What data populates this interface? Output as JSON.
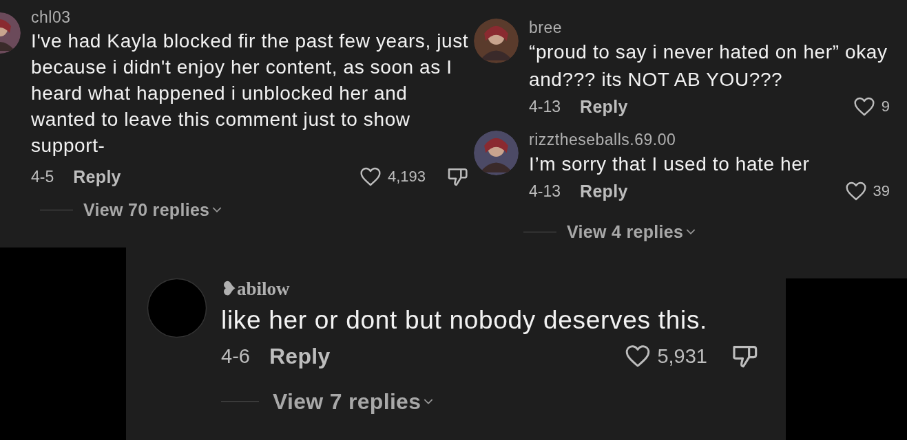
{
  "panels": [
    {
      "comments": [
        {
          "avatar_blank": false,
          "username": "chl03",
          "text": "I've had Kayla blocked fir the past few years, just because i didn't enjoy her content, as soon as I heard what happened i unblocked her and wanted to leave this comment just to show support-",
          "date": "4-5",
          "reply": "Reply",
          "likes": "4,193",
          "dislike": true
        }
      ],
      "view_replies": "View 70 replies"
    },
    {
      "comments": [
        {
          "avatar_blank": false,
          "username": "bree",
          "text": "“proud to say i never hated on her” okay and??? its NOT AB YOU???",
          "date": "4-13",
          "reply": "Reply",
          "likes": "9",
          "dislike": false
        },
        {
          "avatar_blank": false,
          "username": "rizztheseballs.69.00",
          "text": "I’m sorry that I used to hate her",
          "date": "4-13",
          "reply": "Reply",
          "likes": "39",
          "dislike": false
        }
      ],
      "view_replies": "View 4 replies"
    },
    {
      "comments": [
        {
          "avatar_blank": true,
          "username": "❥abilow",
          "text": "like her or dont but nobody deserves this.",
          "date": "4-6",
          "reply": "Reply",
          "likes": "5,931",
          "dislike": true
        }
      ],
      "view_replies": "View 7 replies"
    }
  ]
}
